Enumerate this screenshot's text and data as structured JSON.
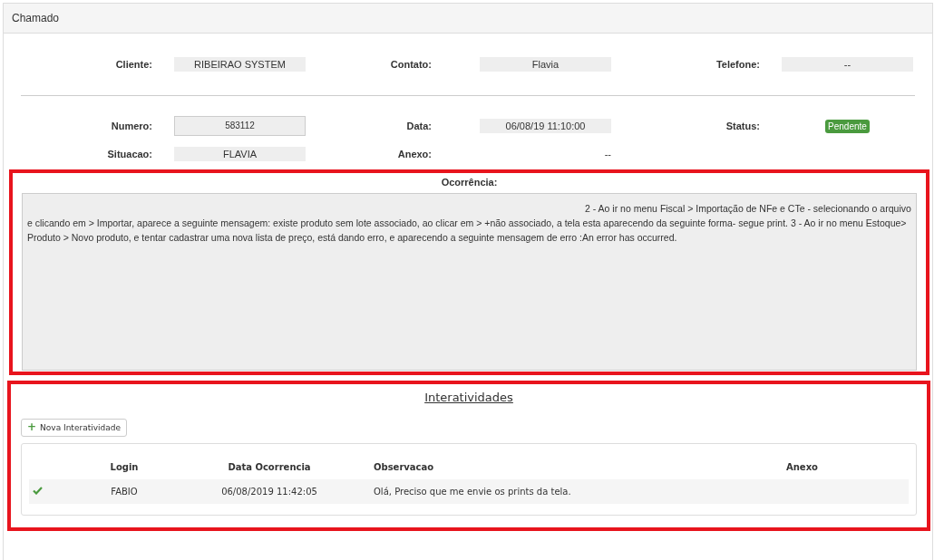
{
  "panel": {
    "title": "Chamado"
  },
  "fields_top": [
    {
      "label": "Cliente:",
      "value": "RIBEIRAO SYSTEM"
    },
    {
      "label": "Contato:",
      "value": "Flavia"
    },
    {
      "label": "Telefone:",
      "value": "--"
    }
  ],
  "fields": [
    {
      "label": "Numero:",
      "value": "583112",
      "kind": "input"
    },
    {
      "label": "Data:",
      "value": "06/08/19 11:10:00",
      "kind": "box"
    },
    {
      "label": "Status:",
      "value": "Pendente",
      "kind": "badge",
      "color": "#4a9a3e"
    },
    {
      "label": "Situacao:",
      "value": "FLAVIA",
      "kind": "box"
    },
    {
      "label": "Anexo:",
      "value": "--",
      "kind": "plain"
    }
  ],
  "ocorrencia": {
    "title": "Ocorrência:",
    "text": "2 - Ao ir no menu Fiscal > Importação de NFe e CTe - selecionando o arquivo e clicando em > Importar, aparece a seguinte mensagem: existe produto sem lote associado, ao clicar em > +não associado, a tela esta aparecendo da seguinte forma- segue print. 3 - Ao ir no menu Estoque> Produto > Novo produto, e tentar cadastrar uma nova lista de preço, está dando erro, e aparecendo a seguinte mensagem de erro :An error has occurred."
  },
  "interatividades": {
    "title": "Interatividades",
    "new_button": "+",
    "new_label": "Nova Interatividade",
    "columns": [
      "Login",
      "Data Ocorrencia",
      "Observacao",
      "Anexo"
    ],
    "rows": [
      {
        "done": true,
        "login": "FABIO",
        "date": "06/08/2019 11:42:05",
        "note": "Olá, Preciso que me envie os prints da tela."
      }
    ]
  }
}
